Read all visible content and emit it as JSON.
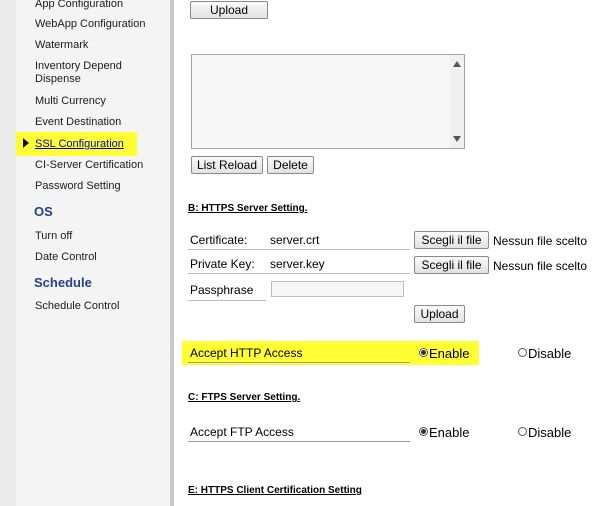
{
  "sidebar": {
    "items": [
      {
        "label": "App Configuration"
      },
      {
        "label": "WebApp Configuration"
      },
      {
        "label": "Watermark"
      },
      {
        "label": "Inventory Depend Dispense"
      },
      {
        "label": "Multi Currency"
      },
      {
        "label": "Event Destination"
      },
      {
        "label": "SSL Configuration"
      },
      {
        "label": "CI-Server Certification"
      },
      {
        "label": "Password Setting"
      }
    ],
    "os_header": "OS",
    "os_items": [
      {
        "label": "Turn off"
      },
      {
        "label": "Date Control"
      }
    ],
    "schedule_header": "Schedule",
    "schedule_items": [
      {
        "label": "Schedule Control"
      }
    ]
  },
  "top": {
    "upload_label": "Upload",
    "list_reload_label": "List Reload",
    "delete_label": "Delete"
  },
  "https": {
    "title": "B: HTTPS Server Setting.",
    "certificate": {
      "label": "Certificate:",
      "value": "server.crt",
      "choose_label": "Scegli il file",
      "status": "Nessun file scelto"
    },
    "private_key": {
      "label": "Private Key:",
      "value": "server.key",
      "choose_label": "Scegli il file",
      "status": "Nessun file scelto"
    },
    "passphrase": {
      "label": "Passphrase",
      "value": ""
    },
    "upload_label": "Upload",
    "accept_http": {
      "label": "Accept HTTP Access",
      "enable_label": "Enable",
      "disable_label": "Disable",
      "selected": "Enable"
    }
  },
  "ftps": {
    "title": "C: FTPS Server Setting.",
    "accept_ftp": {
      "label": "Accept FTP Access",
      "enable_label": "Enable",
      "disable_label": "Disable",
      "selected": "Enable"
    }
  },
  "https_client": {
    "title": "E: HTTPS Client Certification Setting"
  },
  "colors": {
    "highlight": "#ffff33",
    "link": "#0000cc",
    "section_header": "#27408b"
  }
}
